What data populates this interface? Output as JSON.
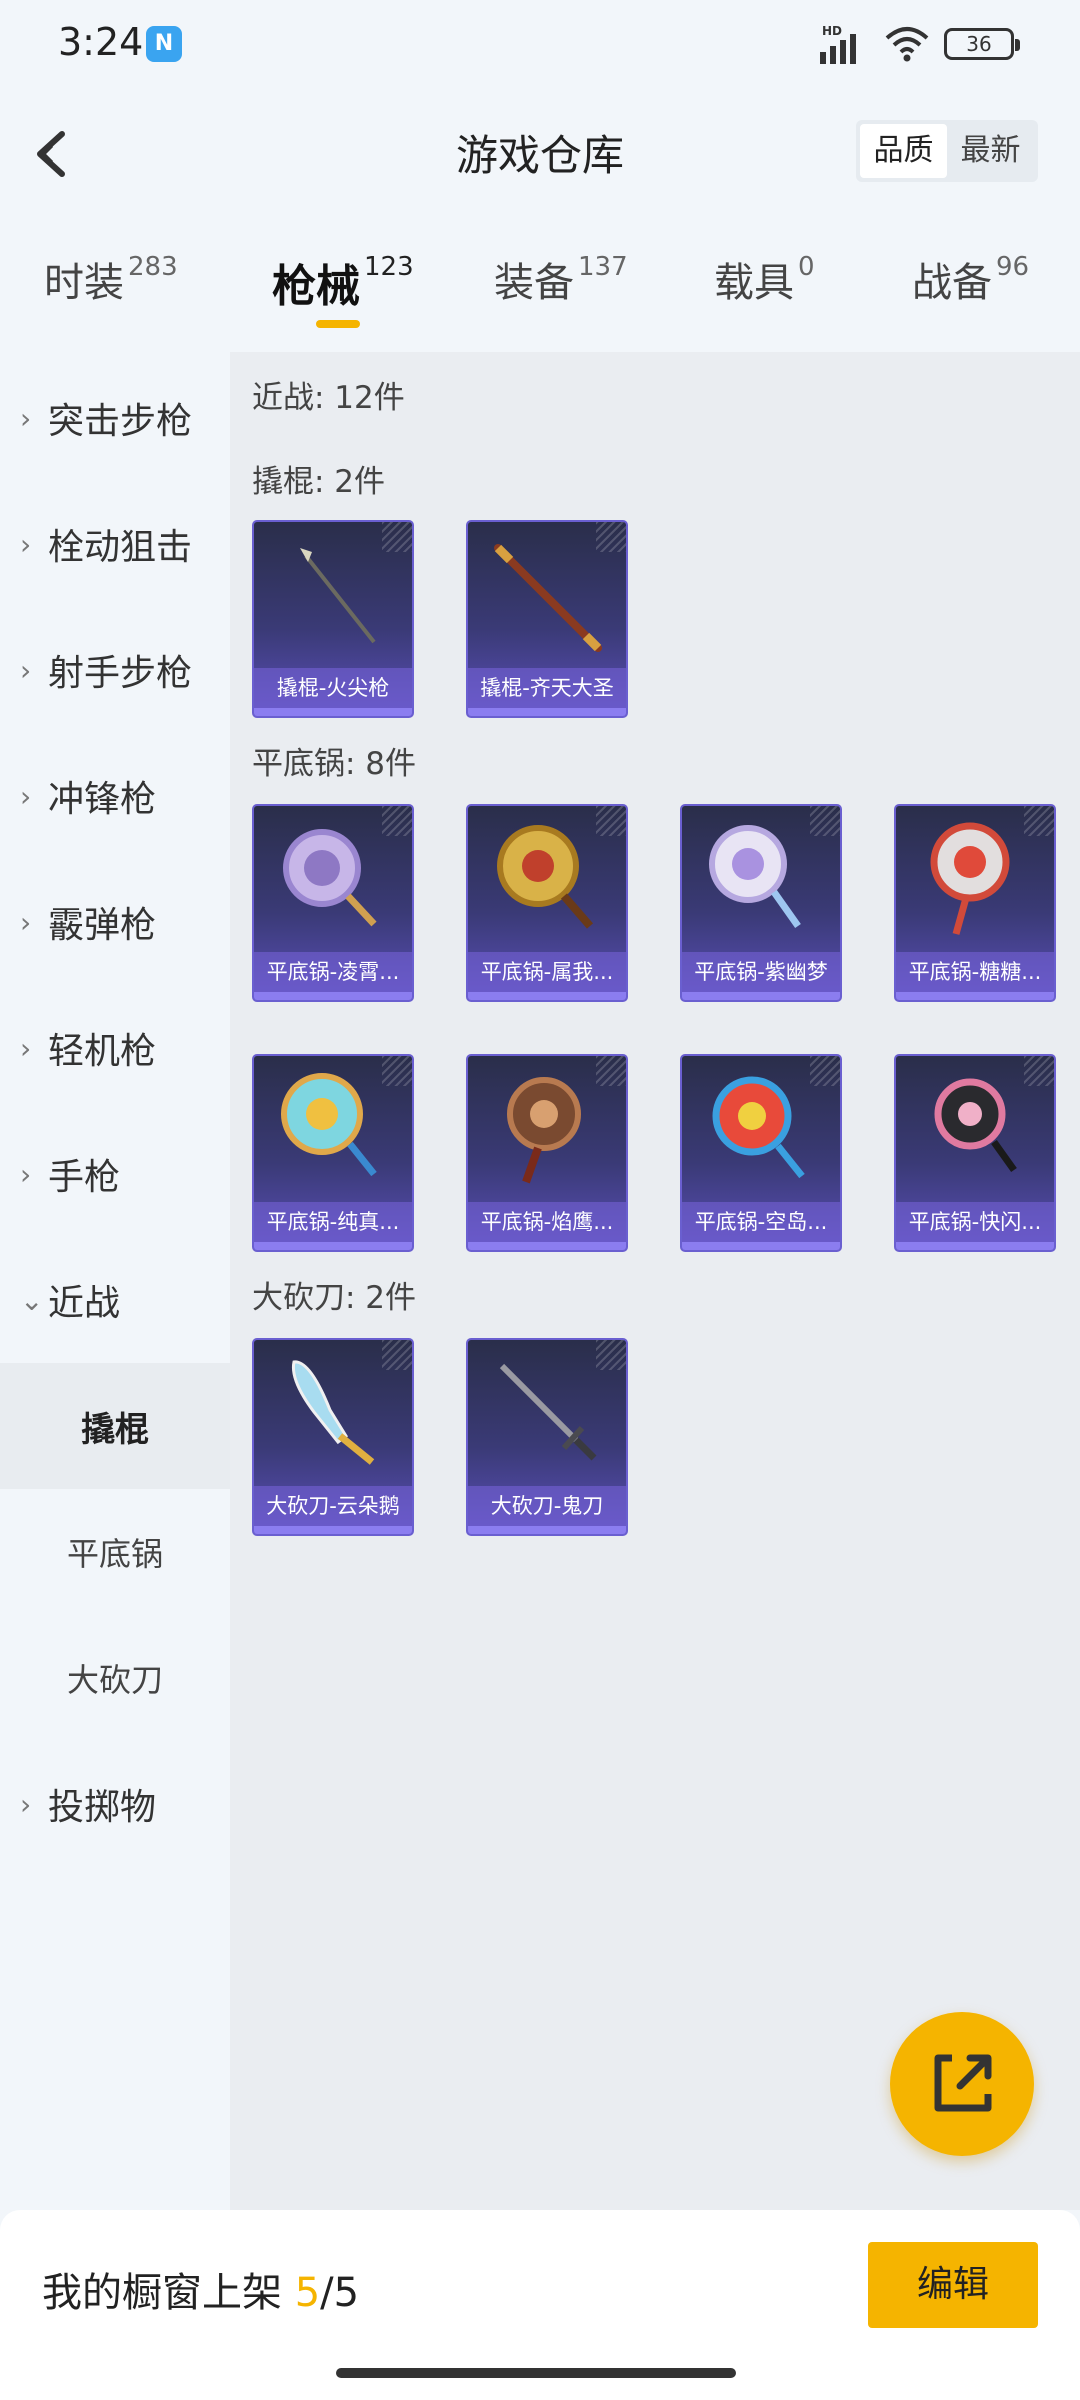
{
  "status": {
    "time": "3:24",
    "nfc_label": "N",
    "hd_label": "HD",
    "battery": "36"
  },
  "header": {
    "title": "游戏仓库",
    "sort_quality": "品质",
    "sort_latest": "最新"
  },
  "tabs": [
    {
      "label": "时装",
      "count": "283"
    },
    {
      "label": "枪械",
      "count": "123"
    },
    {
      "label": "装备",
      "count": "137"
    },
    {
      "label": "载具",
      "count": "0"
    },
    {
      "label": "战备",
      "count": "96"
    }
  ],
  "active_tab_index": 1,
  "sidebar": {
    "items": [
      "突击步枪",
      "栓动狙击",
      "射手步枪",
      "冲锋枪",
      "霰弹枪",
      "轻机枪",
      "手枪",
      "近战"
    ],
    "sub_items": [
      "撬棍",
      "平底锅",
      "大砍刀"
    ],
    "active_sub": "撬棍",
    "last_item": "投掷物"
  },
  "main": {
    "category_header": "近战: 12件",
    "sections": [
      {
        "header": "撬棍: 2件",
        "items": [
          "撬棍-火尖枪",
          "撬棍-齐天大圣"
        ]
      },
      {
        "header": "平底锅: 8件",
        "items": [
          "平底锅-凌霄...",
          "平底锅-属我...",
          "平底锅-紫幽梦",
          "平底锅-糖糖...",
          "平底锅-纯真...",
          "平底锅-焰鹰...",
          "平底锅-空岛...",
          "平底锅-快闪..."
        ]
      },
      {
        "header": "大砍刀: 2件",
        "items": [
          "大砍刀-云朵鹅",
          "大砍刀-鬼刀"
        ]
      }
    ]
  },
  "bottom": {
    "label": "我的橱窗上架 ",
    "count_current": "5",
    "count_sep_total": "/5",
    "edit_label": "编辑"
  },
  "colors": {
    "accent": "#f5b400",
    "card_border": "#6a5fd0",
    "card_bg": "#3a3a76"
  }
}
